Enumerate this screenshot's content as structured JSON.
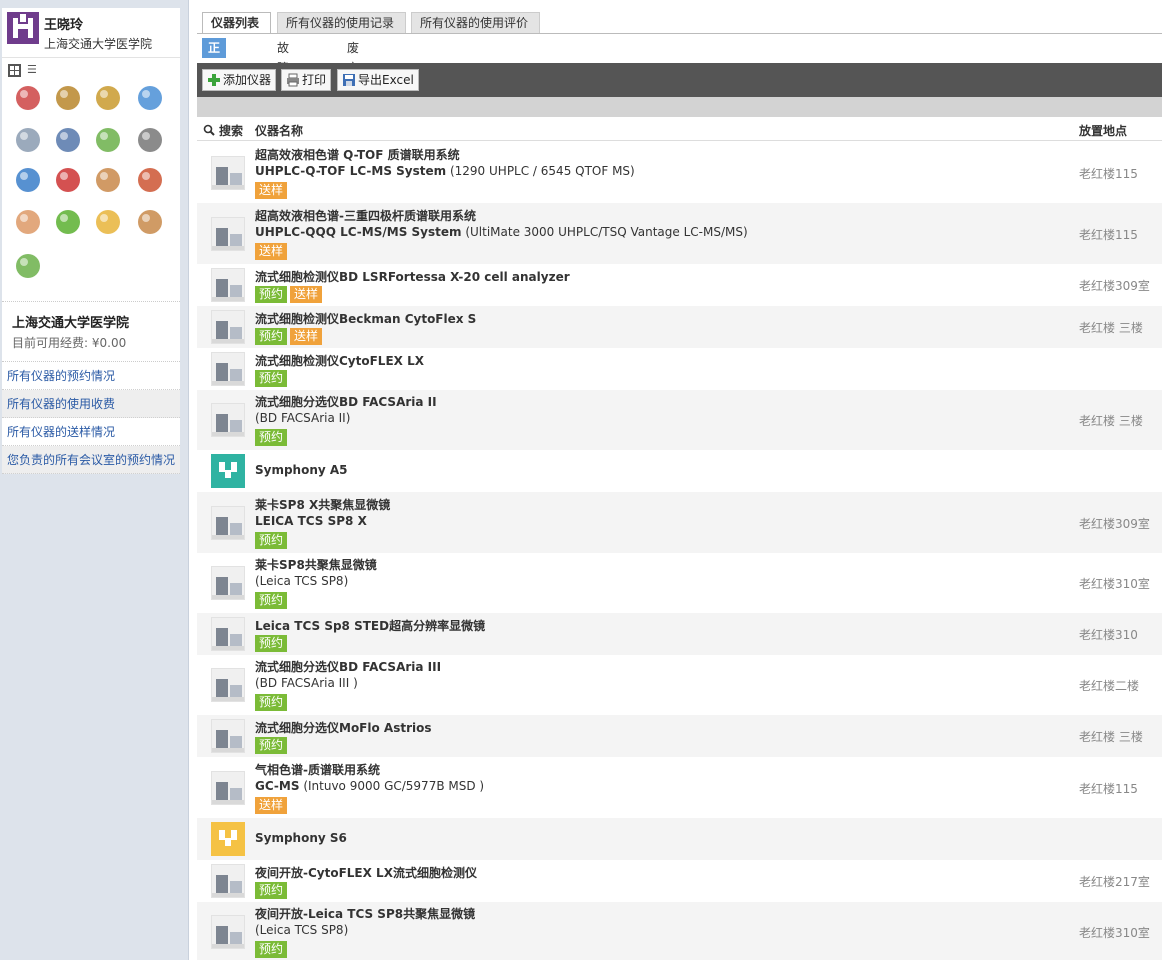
{
  "user": {
    "name": "王晓玲",
    "org": "上海交通大学医学院"
  },
  "sidebar": {
    "view_modes": [
      "grid-icon",
      "list-icon"
    ],
    "icons": [
      "certificate-icon",
      "money-bag-icon",
      "lock-door-icon",
      "thermometer-icon",
      "gears-icon",
      "user-group-icon",
      "chart-blocks-icon",
      "camera-icon",
      "globe-search-icon",
      "chemicals-icon",
      "user-icon",
      "home-icon",
      "clock-house-icon",
      "chat-bubble-icon",
      "folder-icon",
      "people-icon",
      "chart-blocks-2-icon"
    ],
    "org_name": "上海交通大学医学院",
    "fund_text": "目前可用经费: ¥0.00",
    "links": [
      "所有仪器的预约情况",
      "所有仪器的使用收费",
      "所有仪器的送样情况",
      "您负责的所有会议室的预约情况"
    ]
  },
  "tabs": [
    "仪器列表",
    "所有仪器的使用记录",
    "所有仪器的使用评价"
  ],
  "subtabs": [
    "正常设备",
    "故障设备",
    "废弃设备"
  ],
  "toolbar": {
    "add": "添加仪器",
    "print": "打印",
    "export": "导出Excel"
  },
  "table": {
    "headers": {
      "search": "搜索",
      "name": "仪器名称",
      "location": "放置地点"
    },
    "rows": [
      {
        "title": "超高效液相色谱 Q-TOF 质谱联用系统",
        "sub_bold": "UHPLC-Q-TOF LC-MS System",
        "sub_rest": " (1290 UHPLC / 6545 QTOF MS)",
        "tags": [
          "送样"
        ],
        "location": "老红楼115"
      },
      {
        "title": "超高效液相色谱-三重四极杆质谱联用系统",
        "sub_bold": "UHPLC-QQQ LC-MS/MS System",
        "sub_rest": " (UltiMate 3000 UHPLC/TSQ Vantage LC-MS/MS)",
        "tags": [
          "送样"
        ],
        "location": "老红楼115"
      },
      {
        "title": "流式细胞检测仪BD LSRFortessa X-20 cell analyzer",
        "sub_bold": "",
        "sub_rest": "",
        "tags": [
          "预约",
          "送样"
        ],
        "location": "老红楼309室"
      },
      {
        "title": "流式细胞检测仪Beckman CytoFlex S",
        "sub_bold": "",
        "sub_rest": "",
        "tags": [
          "预约",
          "送样"
        ],
        "location": "老红楼 三楼"
      },
      {
        "title": "流式细胞检测仪CytoFLEX LX",
        "sub_bold": "",
        "sub_rest": "",
        "tags": [
          "预约"
        ],
        "location": ""
      },
      {
        "title": "流式细胞分选仪BD FACSAria II",
        "sub_bold": "",
        "sub_rest": "(BD FACSAria II)",
        "tags": [
          "预约"
        ],
        "location": "老红楼 三楼"
      },
      {
        "title": "Symphony A5",
        "sub_bold": "",
        "sub_rest": "",
        "tags": [],
        "location": ""
      },
      {
        "title": "莱卡SP8 X共聚焦显微镜",
        "sub_bold": "LEICA TCS SP8 X",
        "sub_rest": "",
        "tags": [
          "预约"
        ],
        "location": "老红楼309室"
      },
      {
        "title": "莱卡SP8共聚焦显微镜",
        "sub_bold": "",
        "sub_rest": "(Leica TCS SP8)",
        "tags": [
          "预约"
        ],
        "location": "老红楼310室"
      },
      {
        "title": "Leica TCS Sp8 STED超高分辨率显微镜",
        "sub_bold": "",
        "sub_rest": "",
        "tags": [
          "预约"
        ],
        "location": "老红楼310"
      },
      {
        "title": "流式细胞分选仪BD FACSAria III",
        "sub_bold": "",
        "sub_rest": "(BD FACSAria III )",
        "tags": [
          "预约"
        ],
        "location": "老红楼二楼"
      },
      {
        "title": "流式细胞分选仪MoFlo Astrios",
        "sub_bold": "",
        "sub_rest": "",
        "tags": [
          "预约"
        ],
        "location": "老红楼 三楼"
      },
      {
        "title": "气相色谱-质谱联用系统",
        "sub_bold": "GC-MS",
        "sub_rest": " (Intuvo 9000 GC/5977B MSD )",
        "tags": [
          "送样"
        ],
        "location": "老红楼115"
      },
      {
        "title": "Symphony S6",
        "sub_bold": "",
        "sub_rest": "",
        "tags": [],
        "location": ""
      },
      {
        "title": "夜间开放-CytoFLEX LX流式细胞检测仪",
        "sub_bold": "",
        "sub_rest": "",
        "tags": [
          "预约"
        ],
        "location": "老红楼217室"
      },
      {
        "title": "夜间开放-Leica TCS SP8共聚焦显微镜",
        "sub_bold": "",
        "sub_rest": "(Leica TCS SP8)",
        "tags": [
          "预约"
        ],
        "location": "老红楼310室"
      }
    ]
  },
  "colors": {
    "accent": "#5e9bd9",
    "link": "#2a5aa5",
    "tag_reserve": "#7bbb37",
    "tag_sample": "#f0a23b",
    "toolbar": "#555555",
    "avatar": "#6f3c8c"
  }
}
